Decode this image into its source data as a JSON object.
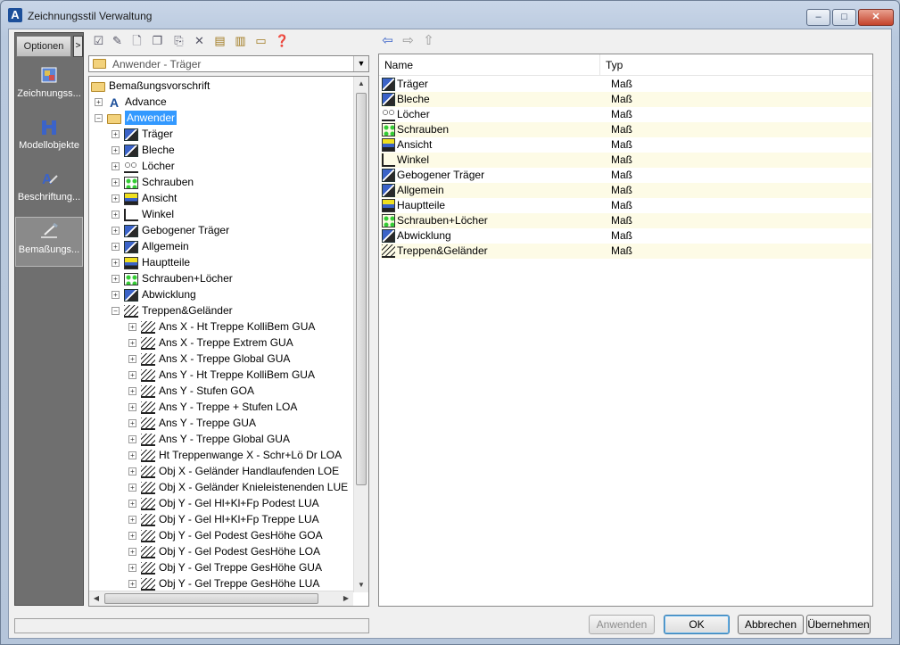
{
  "window": {
    "title": "Zeichnungsstil Verwaltung",
    "btn_min": "–",
    "btn_max": "□",
    "btn_close": "✕"
  },
  "options_bar": {
    "header": "Optionen",
    "arrow": ">",
    "items": [
      {
        "label": "Zeichnungss...",
        "icon": "drawing-style-icon"
      },
      {
        "label": "Modellobjekte",
        "icon": "model-objects-icon"
      },
      {
        "label": "Beschriftung...",
        "icon": "labeling-icon"
      },
      {
        "label": "Bemaßungs...",
        "icon": "dimensioning-icon",
        "selected": true
      }
    ]
  },
  "toolbar": {
    "icons": [
      "checkbox-icon",
      "edit-icon",
      "new-icon",
      "copy-icon",
      "paste-icon",
      "delete-icon",
      "import-icon",
      "export-icon",
      "display-icon",
      "help-icon"
    ],
    "nav_icons": [
      "back-arrow-icon",
      "forward-arrow-icon",
      "up-arrow-icon"
    ]
  },
  "combo": {
    "value": "Anwender - Träger"
  },
  "tree": {
    "root": "Bemaßungsvorschrift",
    "advance": "Advance",
    "anwender": "Anwender",
    "children": [
      "Träger",
      "Bleche",
      "Löcher",
      "Schrauben",
      "Ansicht",
      "Winkel",
      "Gebogener Träger",
      "Allgemein",
      "Hauptteile",
      "Schrauben+Löcher",
      "Abwicklung",
      "Treppen&Geländer"
    ],
    "stair_children": [
      "Ans X - Ht Treppe KolliBem GUA",
      "Ans X - Treppe Extrem GUA",
      "Ans X - Treppe Global GUA",
      "Ans Y - Ht Treppe KolliBem GUA",
      "Ans Y - Stufen GOA",
      "Ans Y - Treppe + Stufen LOA",
      "Ans Y - Treppe GUA",
      "Ans Y - Treppe Global GUA",
      "Ht Treppenwange X - Schr+Lö Dr LOA",
      "Obj X - Geländer Handlaufenden LOE",
      "Obj X - Geländer Knieleistenenden LUE",
      "Obj Y - Gel Hl+Kl+Fp Podest LUA",
      "Obj Y - Gel Hl+Kl+Fp Treppe LUA",
      "Obj Y - Gel Podest GesHöhe GOA",
      "Obj Y - Gel Podest GesHöhe LOA",
      "Obj Y - Gel Treppe GesHöhe GUA",
      "Obj Y - Gel Treppe GesHöhe LUA"
    ],
    "expand_plus": "+",
    "expand_minus": "−"
  },
  "list": {
    "col_name": "Name",
    "col_type": "Typ",
    "rows": [
      {
        "name": "Träger",
        "type": "Maß"
      },
      {
        "name": "Bleche",
        "type": "Maß"
      },
      {
        "name": "Löcher",
        "type": "Maß"
      },
      {
        "name": "Schrauben",
        "type": "Maß"
      },
      {
        "name": "Ansicht",
        "type": "Maß"
      },
      {
        "name": "Winkel",
        "type": "Maß"
      },
      {
        "name": "Gebogener Träger",
        "type": "Maß"
      },
      {
        "name": "Allgemein",
        "type": "Maß"
      },
      {
        "name": "Hauptteile",
        "type": "Maß"
      },
      {
        "name": "Schrauben+Löcher",
        "type": "Maß"
      },
      {
        "name": "Abwicklung",
        "type": "Maß"
      },
      {
        "name": "Treppen&Geländer",
        "type": "Maß"
      }
    ]
  },
  "buttons": {
    "apply": "Anwenden",
    "ok": "OK",
    "cancel": "Abbrechen",
    "accept": "Übernehmen"
  }
}
